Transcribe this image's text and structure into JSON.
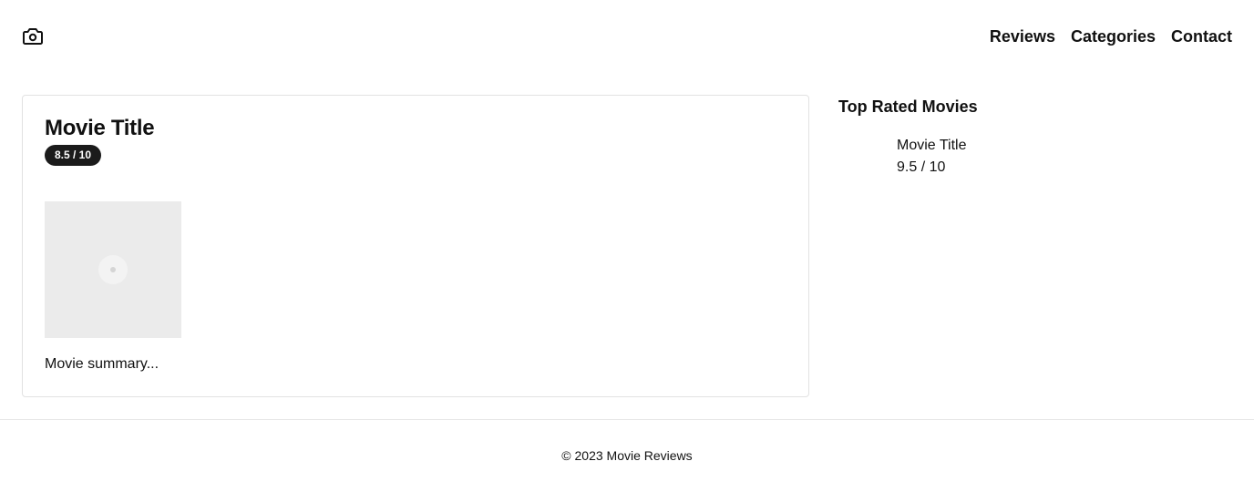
{
  "header": {
    "logo_icon": "camera-icon",
    "nav": [
      {
        "label": "Reviews"
      },
      {
        "label": "Categories"
      },
      {
        "label": "Contact"
      }
    ]
  },
  "main": {
    "movie": {
      "title": "Movie Title",
      "rating": "8.5 / 10",
      "poster_icon": "image-placeholder-icon",
      "summary": "Movie summary..."
    }
  },
  "sidebar": {
    "title": "Top Rated Movies",
    "items": [
      {
        "title": "Movie Title",
        "rating": "9.5 / 10"
      }
    ]
  },
  "footer": {
    "text": "© 2023 Movie Reviews"
  }
}
